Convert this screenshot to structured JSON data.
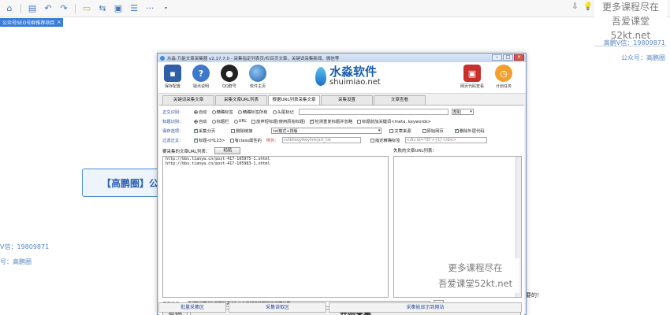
{
  "host": {
    "toolbar": {
      "icons": [
        "home-icon",
        "save-icon",
        "undo-icon",
        "redo-icon",
        "folder-icon",
        "link-icon",
        "image-icon",
        "note-icon",
        "more-icon"
      ],
      "more_label": "···"
    },
    "tab": {
      "label": "公众号SEO号群推荐项目",
      "close": "×"
    },
    "watermark_top": {
      "line1": "更多课程尽在",
      "line2": "吾爱课堂52kt.net"
    },
    "right_text": {
      "wechat": "高鹏V信：19809871",
      "public": "公众号：高鹏圈"
    },
    "left_text": {
      "wechat": "V信：19809871",
      "public": "号：高鹏圈"
    },
    "mindmap_node": "【高鹏圈】公",
    "bottom_note": "重要的！"
  },
  "window": {
    "title": "水淼·万能文章采集器 v2.17.7.0 - 采集指定列表页/栏目页文章，关键词采集新闻、微信等",
    "controls": {
      "min": "–",
      "max": "□",
      "close": "×"
    },
    "toolbar": {
      "save": "保存配置",
      "help": "疑点说明",
      "qq": "QQ群号",
      "home": "软件主页",
      "code": "网页代码查看",
      "task": "计划任务"
    },
    "logo": {
      "cn": "水淼软件",
      "en": "shuimiao.net"
    },
    "tabs": [
      "关键词采集文章",
      "采集文章URL列表",
      "根据URL列表采集文章",
      "采集设置",
      "文章查看"
    ],
    "active_tab": 2,
    "options": {
      "body_label": "正文识别：",
      "body_opts": [
        "自动",
        "精确标签",
        "精确标签所有",
        "头尾标记"
      ],
      "body_btn": "帮助",
      "title_label": "标题识别：",
      "title_opts": [
        "自动",
        "标题栏",
        "URL",
        "放弃短标题(使用原始标题)",
        "检测重复标题并忽略",
        "标题前加关键词<meta, keywords>"
      ],
      "save_label": "保存选项：",
      "save_opts": [
        "采集分页",
        "删除链接"
      ],
      "save_select": "txt格式+排版",
      "save_opts2": [
        "文章来源",
        "原始网页",
        "删除外层代码"
      ],
      "filter_label": "过滤正文：",
      "filter_opts": [
        "标题<H123>",
        "有class属性的"
      ],
      "filter_example_label": "例外：",
      "filter_example": "vvtbllaqylkeylink|art_txt",
      "filter_tag": "指定精确标签",
      "filter_tag_value": "<div id=\"ID\">{1}</div>"
    },
    "url_list": {
      "label": "要采集的文章URL列表：",
      "paste": "粘贴",
      "urls": [
        "http://bbs.tianya.cn/post-417-105975-1.shtml",
        "http://bbs.tianya.cn/post-417-105983-1.shtml"
      ]
    },
    "failed_list": {
      "label": "失败的文章URL列表："
    },
    "save_dir": {
      "label": "保存目录：",
      "path": "F:\\TB运营\\09-杠群相关\\12-公众号SEO号群项目\\文章采集",
      "browse": "..."
    },
    "buttons": {
      "pause": "暂停",
      "start": "开始采集"
    },
    "bottom_tabs": [
      "批量采集区",
      "采集读取区",
      "采集能显示到网站"
    ]
  },
  "watermark_mid": {
    "line1": "更多课程尽在",
    "line2": "吾爱课堂52kt.net"
  }
}
